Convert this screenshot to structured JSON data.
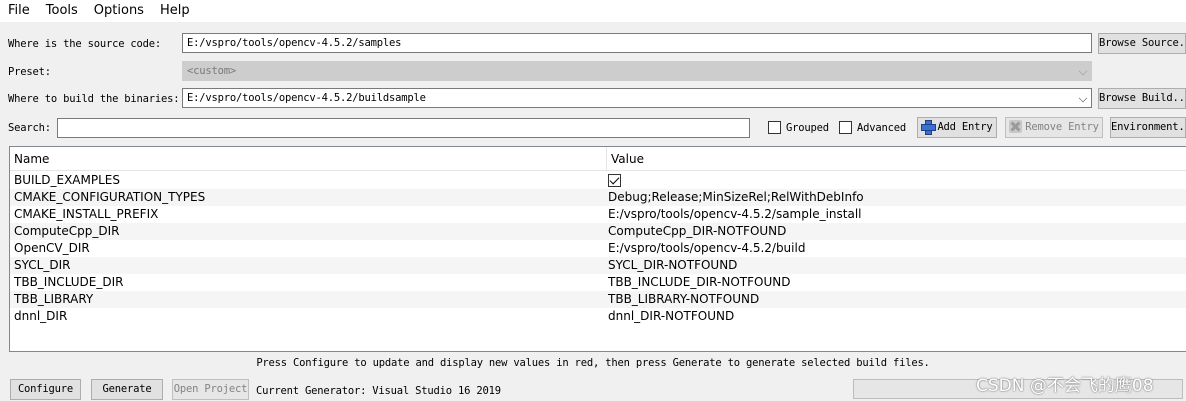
{
  "menu": {
    "file": "File",
    "tools": "Tools",
    "options": "Options",
    "help": "Help"
  },
  "source": {
    "label": "Where is the source code:",
    "value": "E:/vspro/tools/opencv-4.5.2/samples",
    "browse_label": "Browse Source..."
  },
  "preset": {
    "label": "Preset:",
    "value": "<custom>"
  },
  "build": {
    "label": "Where to build the binaries:",
    "value": "E:/vspro/tools/opencv-4.5.2/buildsample",
    "browse_label": "Browse Build..."
  },
  "search": {
    "label": "Search:",
    "value": "",
    "grouped_label": "Grouped",
    "advanced_label": "Advanced",
    "add_entry_label": "Add Entry",
    "remove_entry_label": "Remove Entry",
    "environment_label": "Environment..."
  },
  "table": {
    "headers": {
      "name": "Name",
      "value": "Value"
    },
    "rows": [
      {
        "name": "BUILD_EXAMPLES",
        "value": ""
      },
      {
        "name": "CMAKE_CONFIGURATION_TYPES",
        "value": "Debug;Release;MinSizeRel;RelWithDebInfo"
      },
      {
        "name": "CMAKE_INSTALL_PREFIX",
        "value": "E:/vspro/tools/opencv-4.5.2/sample_install"
      },
      {
        "name": "ComputeCpp_DIR",
        "value": "ComputeCpp_DIR-NOTFOUND"
      },
      {
        "name": "OpenCV_DIR",
        "value": "E:/vspro/tools/opencv-4.5.2/build"
      },
      {
        "name": "SYCL_DIR",
        "value": "SYCL_DIR-NOTFOUND"
      },
      {
        "name": "TBB_INCLUDE_DIR",
        "value": "TBB_INCLUDE_DIR-NOTFOUND"
      },
      {
        "name": "TBB_LIBRARY",
        "value": "TBB_LIBRARY-NOTFOUND"
      },
      {
        "name": "dnnl_DIR",
        "value": "dnnl_DIR-NOTFOUND"
      }
    ]
  },
  "status": {
    "message": "Press Configure to update and display new values in red, then press Generate to generate selected build files."
  },
  "footer": {
    "configure_label": "Configure",
    "generate_label": "Generate",
    "open_project_label": "Open Project",
    "generator_text": "Current Generator: Visual Studio 16 2019"
  },
  "watermark": "CSDN @不会飞的鹰08",
  "colors": {
    "window_bg": "#f0f0f0",
    "table_alt_row": "#f5f5f5",
    "add_icon": "#3b6fd0"
  }
}
